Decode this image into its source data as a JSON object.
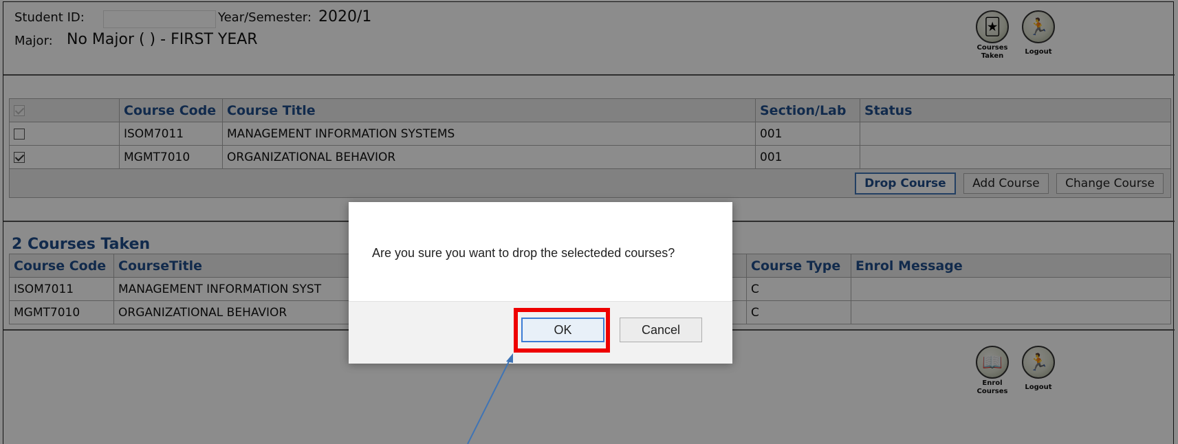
{
  "header": {
    "student_id_label": "Student ID:",
    "year_semester_label": "Year/Semester:",
    "year_semester_value": "2020/1",
    "major_label": "Major:",
    "major_value": "No Major ( ) - FIRST YEAR"
  },
  "top_icons": [
    {
      "label_line1": "Courses",
      "label_line2": "Taken",
      "icon": "courses-taken-icon"
    },
    {
      "label_line1": "Logout",
      "label_line2": "",
      "icon": "logout-icon"
    }
  ],
  "enrol_table": {
    "columns": [
      "Course Code",
      "Course Title",
      "Section/Lab",
      "Status"
    ],
    "rows": [
      {
        "checked": false,
        "code": "ISOM7011",
        "title": "MANAGEMENT INFORMATION SYSTEMS",
        "section": "001",
        "status": ""
      },
      {
        "checked": true,
        "code": "MGMT7010",
        "title": "ORGANIZATIONAL BEHAVIOR",
        "section": "001",
        "status": ""
      }
    ],
    "buttons": {
      "drop": "Drop Course",
      "add": "Add Course",
      "change": "Change Course"
    }
  },
  "taken_section": {
    "title": "2 Courses Taken",
    "columns": [
      "Course Code",
      "CourseTitle",
      "Course Type",
      "Enrol Message"
    ],
    "rows": [
      {
        "code": "ISOM7011",
        "title": "MANAGEMENT INFORMATION SYST",
        "type": "C",
        "message": ""
      },
      {
        "code": "MGMT7010",
        "title": "ORGANIZATIONAL BEHAVIOR",
        "type": "C",
        "message": ""
      }
    ]
  },
  "bottom_icons": [
    {
      "label_line1": "Enrol",
      "label_line2": "Courses",
      "icon": "enrol-courses-icon"
    },
    {
      "label_line1": "Logout",
      "label_line2": "",
      "icon": "logout-icon"
    }
  ],
  "dialog": {
    "message": "Are you sure you want to drop the selecteded courses?",
    "ok_label": "OK",
    "cancel_label": "Cancel"
  },
  "colors": {
    "link_blue": "#1f4e8a",
    "highlight_red": "#ee0000",
    "arrow_blue": "#3f74b5"
  }
}
